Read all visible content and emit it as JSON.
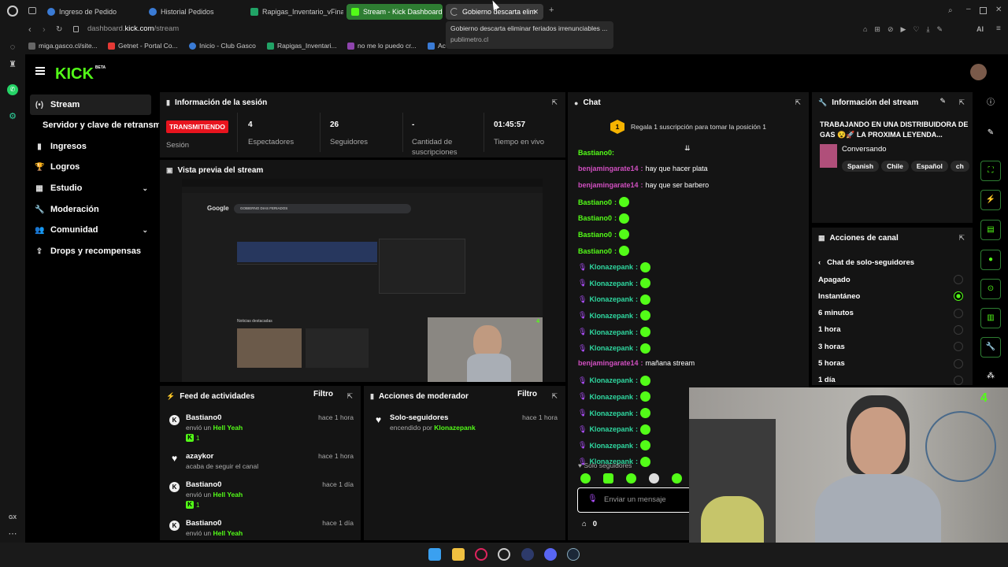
{
  "browser": {
    "tabs": [
      {
        "label": "Ingreso de Pedido"
      },
      {
        "label": "Historial Pedidos"
      },
      {
        "label": "Rapigas_Inventario_vFinal"
      },
      {
        "label": "Stream - Kick Dashboard"
      },
      {
        "label": "Gobierno descarta elim"
      }
    ],
    "address": {
      "prefix": "dashboard.",
      "domain": "kick.com",
      "path": "/stream"
    },
    "bookmarks": [
      {
        "label": "miga.gasco.cl/site..."
      },
      {
        "label": "Getnet - Portal Co..."
      },
      {
        "label": "Inicio - Club Gasco"
      },
      {
        "label": "Rapigas_Inventari..."
      },
      {
        "label": "no me lo puedo cr..."
      },
      {
        "label": "Ac"
      }
    ],
    "tooltip": {
      "title": "Gobierno descarta eliminar feriados irrenunciables ...",
      "source": "publimetro.cl"
    },
    "toolbar_ai": "AI",
    "sidebar_gx": "GX"
  },
  "kick": {
    "logo": "KICK",
    "logo_beta": "BETA",
    "nav": [
      {
        "label": "Stream",
        "icon": "(•)"
      },
      {
        "label": "Servidor y clave de retransmisión",
        "icon": ""
      },
      {
        "label": "Ingresos",
        "icon": "▮"
      },
      {
        "label": "Logros",
        "icon": "🏆"
      },
      {
        "label": "Estudio",
        "icon": "▦"
      },
      {
        "label": "Moderación",
        "icon": "🔧"
      },
      {
        "label": "Comunidad",
        "icon": "👥"
      },
      {
        "label": "Drops y recompensas",
        "icon": "⇪"
      }
    ],
    "session": {
      "title": "Información de la sesión",
      "badge": "TRANSMITIENDO",
      "badge_label": "Sesión",
      "stats": [
        {
          "value": "4",
          "label": "Espectadores"
        },
        {
          "value": "26",
          "label": "Seguidores"
        },
        {
          "value": "-",
          "label": "Cantidad de suscripciones"
        },
        {
          "value": "01:45:57",
          "label": "Tiempo en vivo"
        }
      ]
    },
    "preview": {
      "title": "Vista previa del stream",
      "search_query": "GOBIERNO DIAS FERIADOS",
      "google": "Google",
      "news_heading": "Noticias destacadas",
      "cam_count": "4"
    },
    "feed": {
      "title": "Feed de actividades",
      "filter": "Filtro",
      "items": [
        {
          "name": "Bastiano0",
          "time": "hace 1 hora",
          "sub_prefix": "envió un",
          "sub_bold": "Hell Yeah",
          "chip": "1"
        },
        {
          "name": "azaykor",
          "time": "hace 1 hora",
          "sub_prefix": "acaba de seguir el canal",
          "sub_bold": "",
          "chip": ""
        },
        {
          "name": "Bastiano0",
          "time": "hace 1 día",
          "sub_prefix": "envió un",
          "sub_bold": "Hell Yeah",
          "chip": "1"
        },
        {
          "name": "Bastiano0",
          "time": "hace 1 día",
          "sub_prefix": "envió un",
          "sub_bold": "Hell Yeah",
          "chip": ""
        }
      ]
    },
    "modactions": {
      "title": "Acciones de moderador",
      "filter": "Filtro",
      "items": [
        {
          "name": "Solo-seguidores",
          "time": "hace 1 hora",
          "sub_prefix": "encendido por",
          "sub_bold": "Klonazepank"
        }
      ]
    },
    "chat": {
      "title": "Chat",
      "gift_rank": "1",
      "gift_text": "Regala 1 suscripción para tomar la posición 1",
      "partial_top": "Bastiano0:",
      "messages": [
        {
          "user": "benjamingarate14",
          "color": "#d04fc0",
          "text": "hay que hacer plata",
          "emote": false,
          "mic": false
        },
        {
          "user": "benjamingarate14",
          "color": "#d04fc0",
          "text": "hay que ser barbero",
          "emote": false,
          "mic": false
        },
        {
          "user": "Bastiano0",
          "color": "#53fc18",
          "text": "",
          "emote": true,
          "mic": false
        },
        {
          "user": "Bastiano0",
          "color": "#53fc18",
          "text": "",
          "emote": true,
          "mic": false
        },
        {
          "user": "Bastiano0",
          "color": "#53fc18",
          "text": "",
          "emote": true,
          "mic": false
        },
        {
          "user": "Bastiano0",
          "color": "#53fc18",
          "text": "",
          "emote": true,
          "mic": false
        },
        {
          "user": "Klonazepank",
          "color": "#2fd8a0",
          "text": "",
          "emote": true,
          "mic": true
        },
        {
          "user": "Klonazepank",
          "color": "#2fd8a0",
          "text": "",
          "emote": true,
          "mic": true
        },
        {
          "user": "Klonazepank",
          "color": "#2fd8a0",
          "text": "",
          "emote": true,
          "mic": true
        },
        {
          "user": "Klonazepank",
          "color": "#2fd8a0",
          "text": "",
          "emote": true,
          "mic": true
        },
        {
          "user": "Klonazepank",
          "color": "#2fd8a0",
          "text": "",
          "emote": true,
          "mic": true
        },
        {
          "user": "Klonazepank",
          "color": "#2fd8a0",
          "text": "",
          "emote": true,
          "mic": true
        },
        {
          "user": "benjamingarate14",
          "color": "#d04fc0",
          "text": "mañana stream",
          "emote": false,
          "mic": false
        },
        {
          "user": "Klonazepank",
          "color": "#2fd8a0",
          "text": "",
          "emote": true,
          "mic": true
        },
        {
          "user": "Klonazepank",
          "color": "#2fd8a0",
          "text": "",
          "emote": true,
          "mic": true
        },
        {
          "user": "Klonazepank",
          "color": "#2fd8a0",
          "text": "",
          "emote": true,
          "mic": true
        },
        {
          "user": "Klonazepank",
          "color": "#2fd8a0",
          "text": "",
          "emote": true,
          "mic": true
        },
        {
          "user": "Klonazepank",
          "color": "#2fd8a0",
          "text": "",
          "emote": true,
          "mic": true
        },
        {
          "user": "Klonazepank",
          "color": "#2fd8a0",
          "text": "",
          "emote": true,
          "mic": true
        }
      ],
      "followers_only": "Solo seguidores",
      "input_placeholder": "Enviar un mensaje",
      "points": "0"
    },
    "stream_info": {
      "title": "Información del stream",
      "stream_title": "TRABAJANDO EN UNA DISTRIBUIDORA DE GAS 😵🚀 LA PROXIMA LEYENDA...",
      "category": "Conversando",
      "tags": [
        "Spanish",
        "Chile",
        "Español",
        "ch"
      ]
    },
    "channel_actions": {
      "title": "Acciones de canal",
      "subtitle": "Chat de solo-seguidores",
      "options": [
        {
          "label": "Apagado",
          "selected": false
        },
        {
          "label": "Instantáneo",
          "selected": true
        },
        {
          "label": "6 minutos",
          "selected": false
        },
        {
          "label": "1 hora",
          "selected": false
        },
        {
          "label": "3 horas",
          "selected": false
        },
        {
          "label": "5 horas",
          "selected": false
        },
        {
          "label": "1 día",
          "selected": false
        }
      ]
    },
    "webcam_count": "4"
  },
  "colors": {
    "accent": "#53fc18",
    "live": "#e8141e",
    "panel": "#141414"
  }
}
